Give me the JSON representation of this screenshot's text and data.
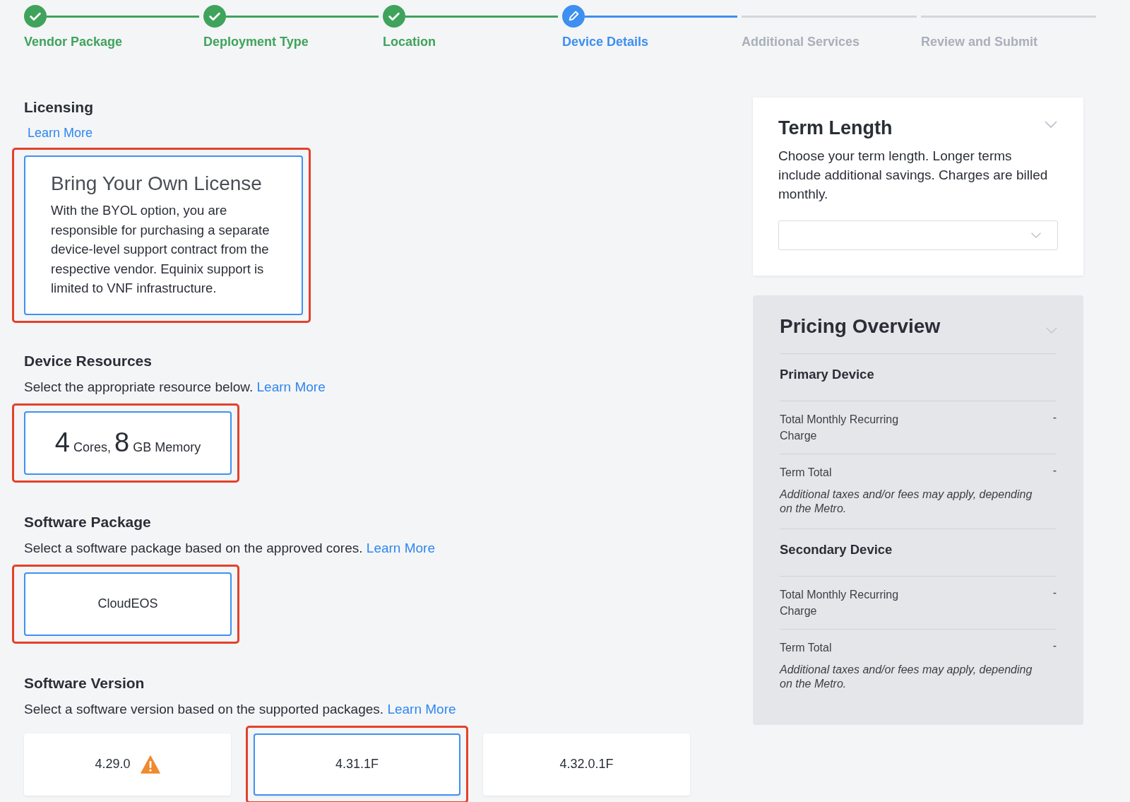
{
  "stepper": [
    {
      "label": "Vendor Package",
      "kind": "complete"
    },
    {
      "label": "Deployment Type",
      "kind": "complete"
    },
    {
      "label": "Location",
      "kind": "complete"
    },
    {
      "label": "Device Details",
      "kind": "current"
    },
    {
      "label": "Additional Services",
      "kind": "upcoming"
    },
    {
      "label": "Review and Submit",
      "kind": "upcoming"
    }
  ],
  "licensing": {
    "title": "Licensing",
    "link": "Learn More",
    "cards": [
      {
        "title": "Bring Your Own License",
        "text": "With the BYOL option, you are responsible for purchasing a separate device-level support contract from the respective vendor. Equinix support is limited to VNF infrastructure.",
        "selected": true,
        "highlighted": true
      }
    ]
  },
  "device_resources": {
    "title": "Device Resources",
    "text": "Select the appropriate resource below.",
    "link": "Learn More",
    "cards": [
      {
        "cores": "4",
        "cores_unit": "Cores,",
        "memory": "8",
        "memory_unit": "GB Memory",
        "selected": true,
        "highlighted": true
      }
    ]
  },
  "software_package": {
    "title": "Software Package",
    "text": "Select a software package based on the approved cores.",
    "link": "Learn More",
    "cards": [
      {
        "label": "CloudEOS",
        "selected": true,
        "highlighted": true
      }
    ]
  },
  "software_version": {
    "title": "Software Version",
    "text": "Select a software version based on the supported packages.",
    "link": "Learn More",
    "cards": [
      {
        "label": "4.29.0",
        "warning": true,
        "selected": false,
        "highlighted": false
      },
      {
        "label": "4.31.1F",
        "warning": false,
        "selected": true,
        "highlighted": true
      },
      {
        "label": "4.32.0.1F",
        "warning": false,
        "selected": false,
        "highlighted": false
      }
    ]
  },
  "term_length": {
    "title": "Term Length",
    "text": "Choose your term length. Longer terms include additional savings. Charges are billed monthly."
  },
  "pricing_overview": {
    "title": "Pricing Overview",
    "groups": [
      {
        "title": "Primary Device",
        "rows": [
          {
            "label": "Total Monthly Recurring Charge",
            "value": "-"
          },
          {
            "label": "Term Total",
            "value": "-"
          }
        ],
        "note": "Additional taxes and/or fees may apply, depending on the Metro."
      },
      {
        "title": "Secondary Device",
        "rows": [
          {
            "label": "Total Monthly Recurring Charge",
            "value": "-"
          },
          {
            "label": "Term Total",
            "value": "-"
          }
        ],
        "note": "Additional taxes and/or fees may apply, depending on the Metro."
      }
    ]
  }
}
